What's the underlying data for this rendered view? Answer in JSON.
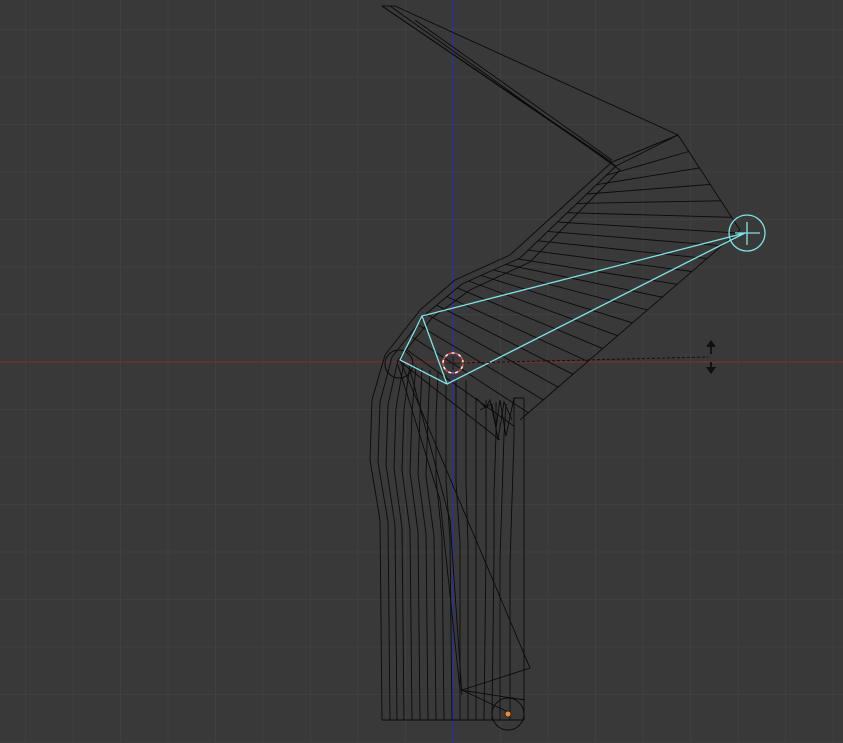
{
  "viewport": {
    "background": "#393939",
    "grid_color": "#404040",
    "x_axis_color": "#8a2a2a",
    "y_axis_color": "#2d2da8"
  },
  "colors": {
    "wireframe": "#0a0a0a",
    "selected_bone": "#7fe3e6",
    "cursor_red": "#e04545",
    "cursor_white": "#f0f0f0",
    "origin": "#f08a2a",
    "gizmo": "#101010"
  },
  "icons": {
    "scale_arrows": "double-headed-vertical-arrow-icon",
    "cursor": "3d-cursor-icon",
    "origin": "object-origin-icon",
    "bone_joint": "bone-joint-circle-icon"
  }
}
